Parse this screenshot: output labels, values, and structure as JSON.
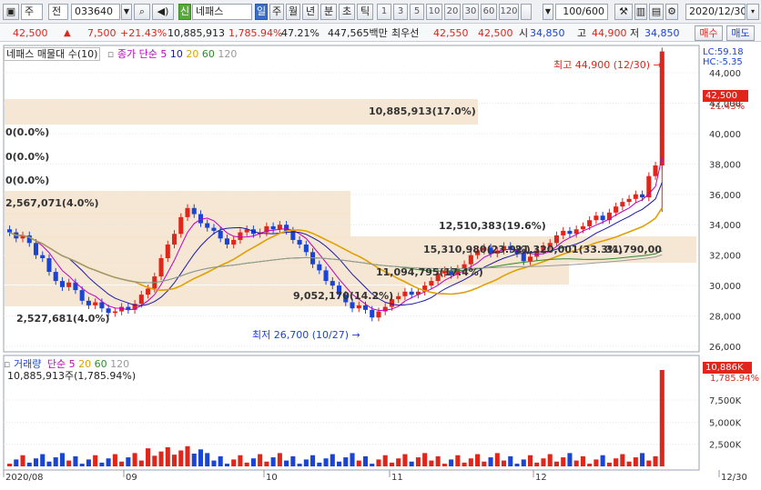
{
  "toolbar": {
    "market": "주",
    "type": "전",
    "code": "033640",
    "new_badge": "신",
    "name": "네패스",
    "periods": [
      "일",
      "주",
      "월",
      "년",
      "분",
      "초",
      "틱"
    ],
    "selected_period": "일",
    "intervals": [
      "1",
      "3",
      "5",
      "10",
      "20",
      "30",
      "60",
      "120"
    ],
    "count": "100/600",
    "date": "2020/12/30"
  },
  "quote": {
    "price": "42,500",
    "change": "7,500",
    "rate": "+21.43%",
    "volume": "10,885,913",
    "volume_ratio": "1,785.94%",
    "turnover": "47.21%",
    "amount": "447,565백만",
    "priority_label": "최우선",
    "ask": "42,550",
    "bid": "42,500",
    "open_label": "시",
    "open": "34,850",
    "high_label": "고",
    "high": "44,900",
    "low_label": "저",
    "low": "34,850",
    "buy": "매수",
    "sell": "매도"
  },
  "colors": {
    "up": "#e0251b",
    "down": "#1a44d6",
    "ma5": "#c000c0",
    "ma10": "#1a1aa8",
    "ma20": "#e0a000",
    "ma60": "#2e8b2e",
    "ma120": "#999999",
    "band": "#f5e3cc"
  },
  "price_legend": {
    "title": "네패스 매물대 수(10)",
    "close_label": "종가",
    "type_label": "단순",
    "mas": [
      "5",
      "10",
      "20",
      "60",
      "120"
    ]
  },
  "price_panel": {
    "lc": "LC:59.18",
    "hc": "HC:-5.35",
    "y_ticks": [
      "44,000",
      "42,000",
      "40,000",
      "38,000",
      "36,000",
      "34,000",
      "32,000",
      "30,000",
      "28,000",
      "26,000"
    ],
    "current_price": "42,500",
    "current_rate": "21.43%",
    "high_note": "최고 44,900 (12/30)",
    "low_note": "최저 26,700 (10/27)",
    "zero_labels": [
      "0(0.0%)",
      "0(0.0%)",
      "0(0.0%)"
    ],
    "band_labels": {
      "b1": "10,885,913(17.0%)",
      "b2": "2,567,071(4.0%)",
      "b3": "12,510,383(19.6%)",
      "b4": "15,310,980(23.9%)",
      "b4b": "21,320,001(33.3%)",
      "b5": "31,790,00",
      "b6": "11,094,795(17.4%)",
      "b7": "9,052,170(14.2%)",
      "b8": "2,527,681(4.0%)"
    }
  },
  "volume_legend": {
    "title": "거래량",
    "type_label": "단순",
    "mas": [
      "5",
      "20",
      "60",
      "120"
    ],
    "value": "10,885,913주(1,785.94%)"
  },
  "volume_panel": {
    "y_ticks": [
      "7,500K",
      "5,000K",
      "2,500K"
    ],
    "current_volume": "10,886K",
    "current_ratio": "1,785.94%"
  },
  "x_axis": [
    "2020/08",
    "09",
    "10",
    "11",
    "12",
    "12/30"
  ]
}
